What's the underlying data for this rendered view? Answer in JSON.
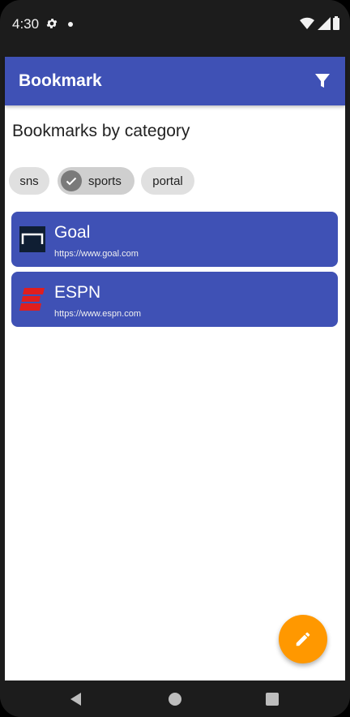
{
  "status_bar": {
    "time": "4:30"
  },
  "app_bar": {
    "title": "Bookmark",
    "filter_icon": "filter-icon",
    "accent_color": "#3f51b5"
  },
  "main": {
    "section_title": "Bookmarks by category",
    "chips": [
      {
        "label": "sns",
        "selected": false
      },
      {
        "label": "sports",
        "selected": true
      },
      {
        "label": "portal",
        "selected": false
      }
    ],
    "bookmarks": [
      {
        "title": "Goal",
        "url": "https://www.goal.com",
        "icon": "goal-logo-icon"
      },
      {
        "title": "ESPN",
        "url": "https://www.espn.com",
        "icon": "espn-logo-icon"
      }
    ]
  },
  "fab": {
    "icon": "pencil-icon",
    "color": "#ff9800"
  },
  "nav_bar": {
    "icons": [
      "back-icon",
      "home-icon",
      "recents-icon"
    ]
  }
}
